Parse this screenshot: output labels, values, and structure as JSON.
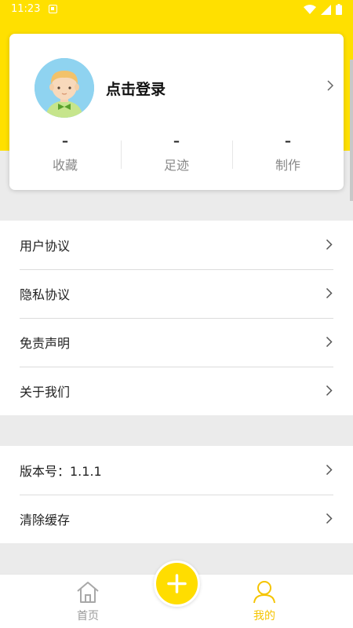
{
  "status_bar": {
    "time": "11:23",
    "icons": [
      "notification-icon",
      "wifi-icon",
      "signal-icon",
      "battery-icon"
    ]
  },
  "profile": {
    "login_text": "点击登录",
    "avatar_icon": "avatar-boy-icon",
    "stats": [
      {
        "value": "–",
        "label": "收藏"
      },
      {
        "value": "–",
        "label": "足迹"
      },
      {
        "value": "–",
        "label": "制作"
      }
    ]
  },
  "menu_group_1": [
    {
      "label": "用户协议"
    },
    {
      "label": "隐私协议"
    },
    {
      "label": "免责声明"
    },
    {
      "label": "关于我们"
    }
  ],
  "menu_group_2": [
    {
      "label": "版本号：1.1.1"
    },
    {
      "label": "清除缓存"
    }
  ],
  "tab_bar": {
    "home": {
      "label": "首页",
      "icon": "home-icon"
    },
    "add": {
      "icon": "plus-icon"
    },
    "mine": {
      "label": "我的",
      "icon": "user-icon"
    }
  },
  "colors": {
    "brand_yellow": "#ffe000",
    "active_tab": "#f5c400",
    "inactive_tab": "#9a9a9a",
    "background": "#ebebeb"
  }
}
